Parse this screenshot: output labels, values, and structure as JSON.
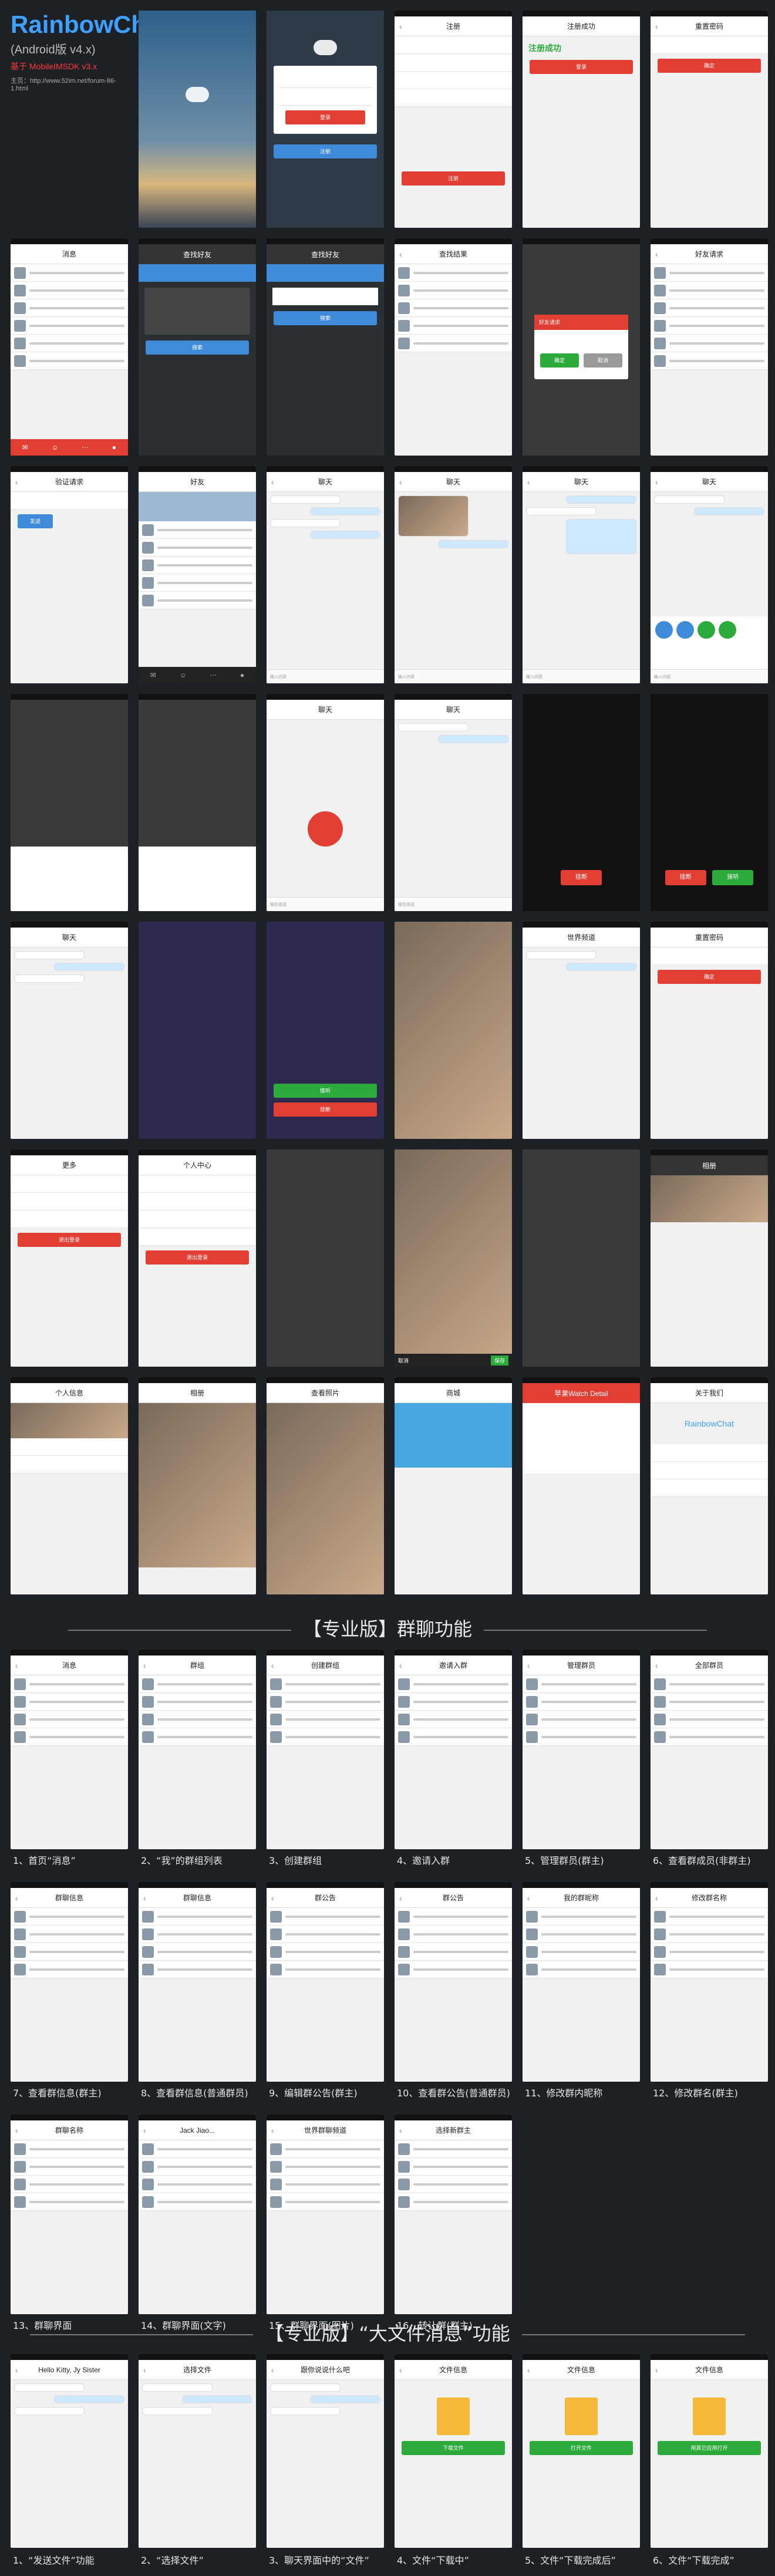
{
  "brand": {
    "title": "RainbowChat",
    "subtitle": "(Android版 v4.x)",
    "red_line": "基于 MobileIMSDK v3.x",
    "url_line": "主页：http://www.52im.net/forum-86-1.html"
  },
  "screens": {
    "login_btn": "登录",
    "register_title": "注册",
    "register_ok": "注册成功",
    "back_pwd": "重置密码",
    "messages": "消息",
    "add_friend": "查找好友",
    "search_result": "查找结果",
    "friend_req": "好友请求",
    "verify": "验证请求",
    "friends": "好友",
    "chat_title": "聊天",
    "send_voice": "按住说话",
    "call_reject": "挂断",
    "call_accept": "接听",
    "world_chat": "世界频道",
    "more": "更多",
    "mine": "个人中心",
    "logout": "退出登录",
    "album": "相册",
    "my_info": "个人信息",
    "view_photo": "查看照片",
    "shop": "商城",
    "watch": "苹果Watch Detail",
    "about": "关于我们",
    "about_brand": "RainbowChat",
    "send": "发送",
    "input_hint": "输入内容"
  },
  "section1": {
    "title": "【专业版】群聊功能"
  },
  "group_captions": [
    "1、首页“消息”",
    "2、“我”的群组列表",
    "3、创建群组",
    "4、邀请入群",
    "5、管理群员(群主)",
    "6、查看群成员(非群主)",
    "7、查看群信息(群主)",
    "8、查看群信息(普通群员)",
    "9、编辑群公告(群主)",
    "10、查看群公告(普通群员)",
    "11、修改群内昵称",
    "12、修改群名(群主)",
    "13、群聊界面",
    "14、群聊界面(文字)",
    "15、群聊界面(图片)",
    "16、转让群(群主)"
  ],
  "group_titles": {
    "messages": "消息",
    "my_groups": "群组",
    "create": "创建群组",
    "invite": "邀请入群",
    "manage": "管理群员",
    "members": "全部群员",
    "group_info": "群聊信息",
    "notice": "群公告",
    "nick": "我的群昵称",
    "rename": "修改群名称",
    "group_chat": "群聊名称",
    "group_chat2": "Jack Jiao...",
    "group_chat3": "世界群聊频道",
    "transfer": "选择新群主"
  },
  "section2": {
    "title": "【专业版】“大文件消息”功能"
  },
  "file_captions": [
    "1、“发送文件”功能",
    "2、“选择文件”",
    "3、聊天界面中的“文件”",
    "4、文件“下载中”",
    "5、文件“下载完成后”",
    "6、文件“下载完成”"
  ],
  "file_titles": {
    "chat": "Hello Kitty, Jy Sister",
    "select": "选择文件",
    "chat2": "跟你说说什么吧",
    "file_info": "文件信息"
  },
  "file_buttons": {
    "download": "下载文件",
    "open": "打开文件",
    "other_app": "用其它应用打开"
  },
  "common": {
    "search_placeholder": "搜索",
    "ok": "确定",
    "cancel": "取消",
    "save": "保存"
  },
  "colors": {
    "accent_red": "#e33e33",
    "brand_blue": "#3fa0ff",
    "green": "#2bab3b",
    "background": "#1d2126"
  }
}
